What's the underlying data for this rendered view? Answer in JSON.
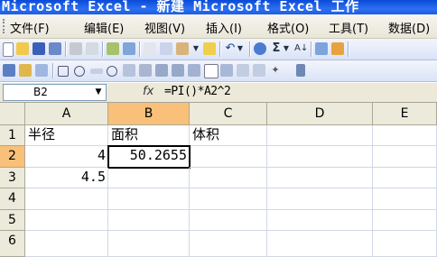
{
  "window": {
    "title": "Microsoft Excel - 新建 Microsoft Excel 工作"
  },
  "menu": {
    "items": [
      "文件(F)",
      "编辑(E)",
      "视图(V)",
      "插入(I)",
      "格式(O)",
      "工具(T)",
      "数据(D)"
    ]
  },
  "toolbar": {
    "standard_icons": [
      "new-icon",
      "open-icon",
      "save-icon",
      "permission-icon",
      "print-icon",
      "print-preview-icon",
      "spelling-icon",
      "research-icon",
      "cut-icon",
      "copy-icon",
      "paste-icon",
      "format-painter-icon",
      "undo-icon",
      "hyperlink-icon",
      "autosum-icon",
      "sort-ascending-icon",
      "chart-icon",
      "drawing-icon"
    ],
    "autosum_label": "Σ",
    "forms_icons": [
      "label-icon",
      "groupbox-icon",
      "button-icon",
      "checkbox-icon",
      "option-icon",
      "listbox-icon",
      "combobox-icon",
      "scrollbar-icon",
      "spinner-icon",
      "properties-icon",
      "code-icon",
      "toggle-grid-icon",
      "run-dialog-icon"
    ]
  },
  "formula_bar": {
    "name_box": "B2",
    "fx": "fx",
    "formula": "=PI()*A2^2"
  },
  "sheet": {
    "columns": [
      "A",
      "B",
      "C",
      "D",
      "E"
    ],
    "rows": [
      "1",
      "2",
      "3",
      "4",
      "5",
      "6"
    ],
    "cells": {
      "A1": "半径",
      "B1": "面积",
      "C1": "体积",
      "A2": "4",
      "B2": "50.2655",
      "A3": "4.5"
    },
    "active_cell": "B2"
  }
}
